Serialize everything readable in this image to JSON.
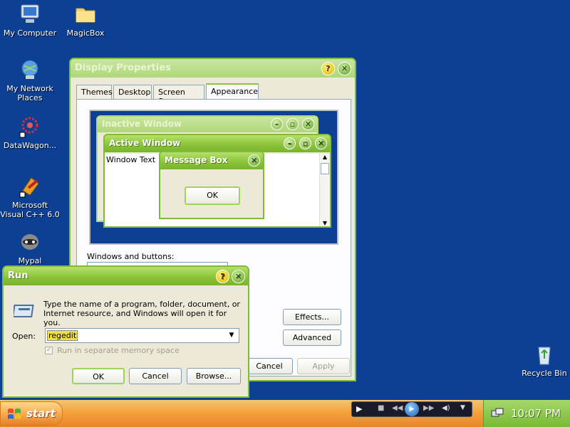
{
  "desktop": {
    "icons": [
      {
        "label": "My Computer",
        "icon": "computer-icon"
      },
      {
        "label": "MagicBox",
        "icon": "folder-icon"
      },
      {
        "label": "My Network Places",
        "icon": "network-icon"
      },
      {
        "label": "DataWagon...",
        "icon": "datawagon-icon"
      },
      {
        "label": "Microsoft Visual C++ 6.0",
        "icon": "visual-cpp-icon"
      },
      {
        "label": "Mypal",
        "icon": "mypal-icon"
      },
      {
        "label": "Recycle Bin",
        "icon": "recycle-bin-icon"
      }
    ]
  },
  "display_properties": {
    "title": "Display Properties",
    "tabs": [
      "Themes",
      "Desktop",
      "Screen Saver",
      "Appearance"
    ],
    "selected_tab": "Appearance",
    "preview": {
      "inactive_title": "Inactive Window",
      "active_title": "Active Window",
      "window_text": "Window Text",
      "message_box_title": "Message Box",
      "message_box_ok": "OK"
    },
    "windows_and_buttons_label": "Windows and buttons:",
    "effects_button": "Effects...",
    "advanced_button": "Advanced",
    "cancel_button": "Cancel",
    "apply_button": "Apply"
  },
  "run_dialog": {
    "title": "Run",
    "description": "Type the name of a program, folder, document, or Internet resource, and Windows will open it for you.",
    "open_label": "Open:",
    "open_value": "regedit",
    "checkbox_label": "Run in separate memory space",
    "ok_button": "OK",
    "cancel_button": "Cancel",
    "browse_button": "Browse..."
  },
  "taskbar": {
    "start_label": "start",
    "clock": "10:07 PM"
  },
  "colors": {
    "desktop": "#0d3f95",
    "accent_green": "#8cc43c",
    "taskbar_orange": "#f4a23c"
  }
}
